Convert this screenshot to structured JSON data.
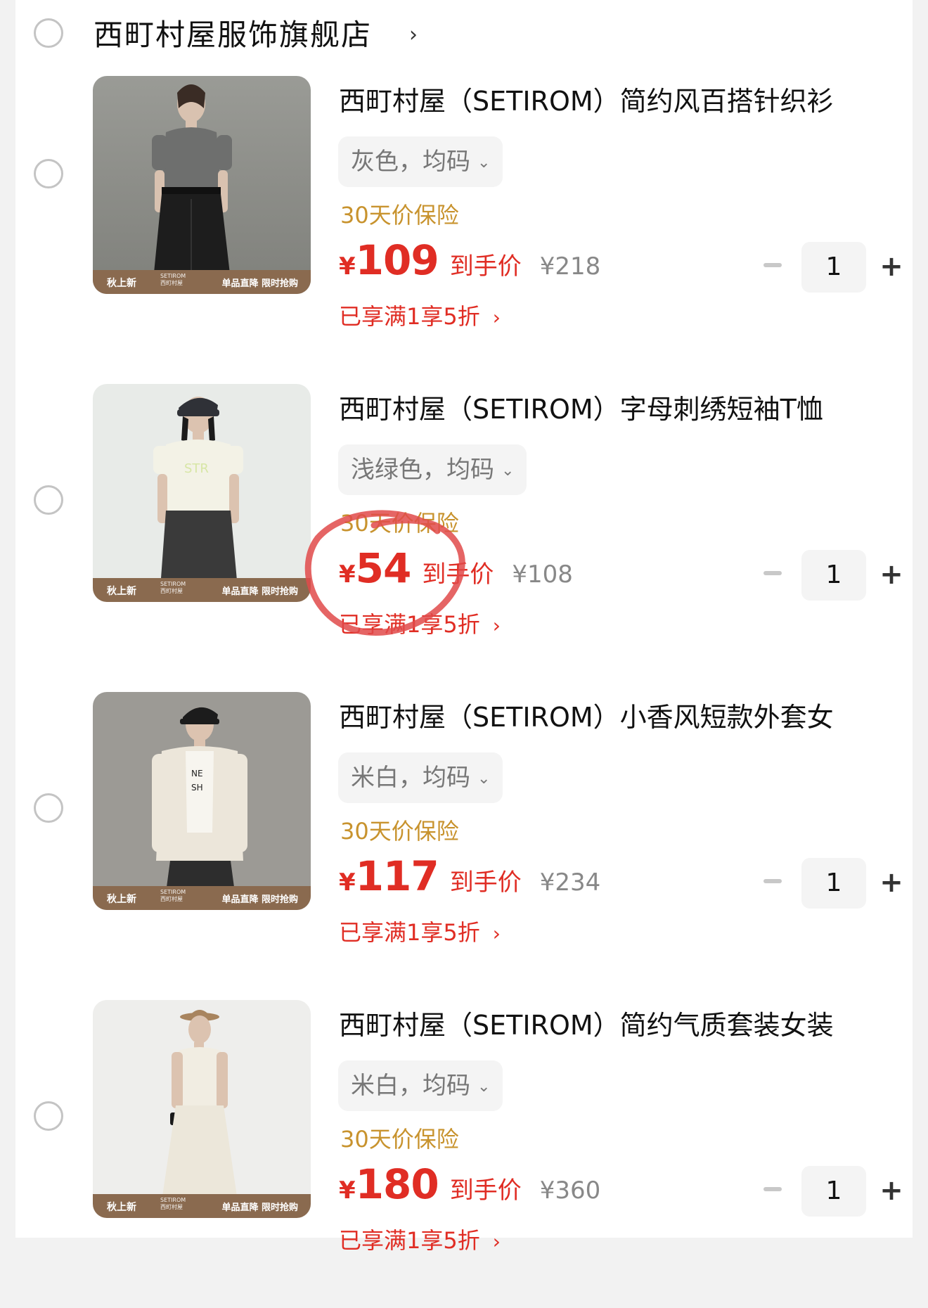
{
  "shop": {
    "name": "西町村屋服饰旗舰店",
    "chevron": "›"
  },
  "items": [
    {
      "title": "西町村屋（SETIROM）简约风百搭针织衫",
      "variant": "灰色，均码",
      "insurance": "30天价保险",
      "currency": "¥",
      "price": "109",
      "price_label": "到手价",
      "original_price": "¥218",
      "discount": "已享满1享5折",
      "quantity": "1",
      "strip_left": "秋上新",
      "strip_mid": "SETIROM 西町村屋",
      "strip_right": "单品直降 限时抢购",
      "colors": {
        "top": "#9a9b96",
        "bottom": "#7f807b",
        "figure_top": "#6e6f6e",
        "figure_bottom": "#1d1d1d"
      }
    },
    {
      "title": "西町村屋（SETIROM）字母刺绣短袖T恤",
      "variant": "浅绿色，均码",
      "insurance": "30天价保险",
      "currency": "¥",
      "price": "54",
      "price_label": "到手价",
      "original_price": "¥108",
      "discount": "已享满1享5折",
      "quantity": "1",
      "strip_left": "秋上新",
      "strip_mid": "SETIROM 西町村屋",
      "strip_right": "单品直降 限时抢购",
      "colors": {
        "top": "#eef0ee",
        "bottom": "#dfe2df",
        "figure_top": "#f3f2e6",
        "figure_bottom": "#3a3a3a"
      }
    },
    {
      "title": "西町村屋（SETIROM）小香风短款外套女",
      "variant": "米白，均码",
      "insurance": "30天价保险",
      "currency": "¥",
      "price": "117",
      "price_label": "到手价",
      "original_price": "¥234",
      "discount": "已享满1享5折",
      "quantity": "1",
      "strip_left": "秋上新",
      "strip_mid": "SETIROM 西町村屋",
      "strip_right": "单品直降 限时抢购",
      "colors": {
        "top": "#a3a19c",
        "bottom": "#8d8b86",
        "figure_top": "#ece6da",
        "figure_bottom": "#2d2d2d"
      }
    },
    {
      "title": "西町村屋（SETIROM）简约气质套装女装",
      "variant": "米白，均码",
      "insurance": "30天价保险",
      "currency": "¥",
      "price": "180",
      "price_label": "到手价",
      "original_price": "¥360",
      "discount": "已享满1享5折",
      "quantity": "1",
      "strip_left": "秋上新",
      "strip_mid": "SETIROM 西町村屋",
      "strip_right": "单品直降 限时抢购",
      "colors": {
        "top": "#eeeeec",
        "bottom": "#e2e1dd",
        "figure_top": "#f1ede2",
        "figure_bottom": "#ece7da"
      }
    }
  ],
  "accent_color": "#e02d24",
  "insurance_color": "#c8932e",
  "annotation": {
    "type": "red-circle",
    "target": "item-2 price"
  }
}
